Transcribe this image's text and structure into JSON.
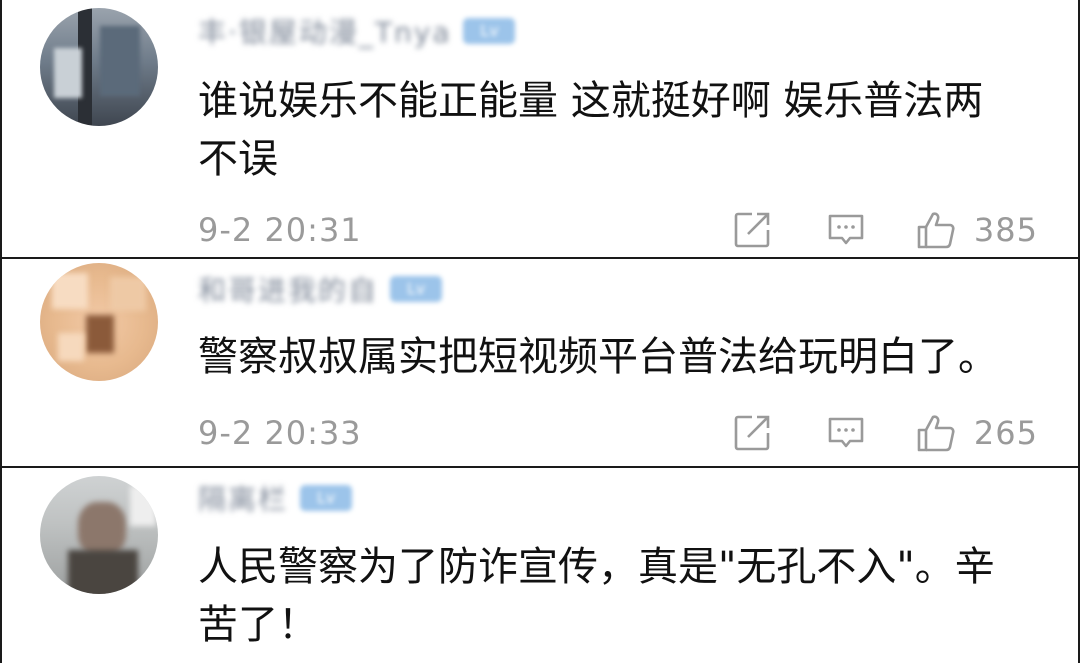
{
  "comments": [
    {
      "username": "丰·银屋动漫_Tnya",
      "level_badge": "Lv",
      "text": "谁说娱乐不能正能量 这就挺好啊 娱乐普法两\n不误",
      "time": "9-2 20:31",
      "likes": "385"
    },
    {
      "username": "和哥进我的自",
      "level_badge": "Lv",
      "text": "警察叔叔属实把短视频平台普法给玩明白了。",
      "time": "9-2 20:33",
      "likes": "265"
    },
    {
      "username": "隔离栏",
      "level_badge": "Lv",
      "text": "人民警察为了防诈宣传，真是\"无孔不入\"。辛\n苦了！"
    }
  ],
  "icons": {
    "share": "share-icon",
    "reply": "reply-icon",
    "like": "thumbs-up-icon"
  },
  "colors": {
    "meta_text": "#9a9a9a",
    "badge": "#9cc4ea"
  }
}
